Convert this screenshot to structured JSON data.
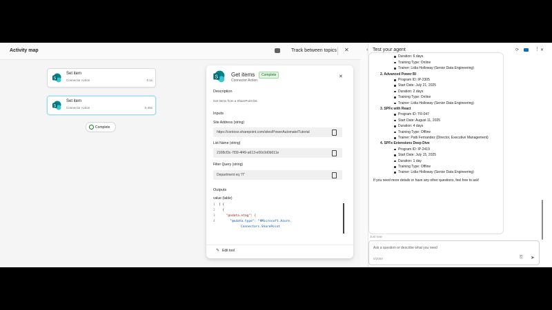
{
  "map": {
    "title": "Activity map",
    "track_label": "Track between topics",
    "nodes": [
      {
        "title": "Set item",
        "subtitle": "Connector Action",
        "meta": "0.1s"
      },
      {
        "title": "Set item",
        "subtitle": "Connector Action",
        "meta": "0.45s"
      }
    ],
    "complete_label": "Complete"
  },
  "panel": {
    "title": "Get items",
    "badge": "Complete",
    "subtitle": "Connector Action",
    "description_heading": "Description",
    "description": "Get items from a SharePoint list.",
    "inputs_heading": "Inputs",
    "fields": [
      {
        "label": "Site Address (string)",
        "value": "https://contoso.sharepoint.com/sites/PowerAutomate/Tutorial"
      },
      {
        "label": "List Name (string)",
        "value": "2108cf3c-7f39-4f49-a613-e00c0d0b011e"
      },
      {
        "label": "Filter Query (string)",
        "value": "Department eq 'IT'"
      }
    ],
    "outputs_heading": "Outputs",
    "value_label": "value (table)",
    "code_lines": [
      {
        "num": "1",
        "text": "[ {"
      },
      {
        "num": "2",
        "text": "  {"
      },
      {
        "num": "3",
        "text": "    \"@odata.etag\": {"
      },
      {
        "num": "4",
        "text": "      \"@odata.type\": \"#Microsoft.Azure."
      }
    ],
    "code_extra": "Connectors.SharePoint",
    "edit_label": "Edit tool"
  },
  "chat": {
    "title": "Test your agent",
    "lines": [
      {
        "text": "Start Date: July 15, 2025",
        "indent": 2,
        "bullet": true
      },
      {
        "text": "Duration: 6 days",
        "indent": 2,
        "bullet": true
      },
      {
        "text": "Training Type: Online",
        "indent": 2,
        "bullet": true
      },
      {
        "text": "Trainer: Lidia Holloway (Senior Data Engineering)",
        "indent": 2,
        "bullet": true
      },
      {
        "text": "2. Advanced Power BI",
        "indent": 1,
        "bullet": false
      },
      {
        "text": "Program ID: IP-2305",
        "indent": 2,
        "bullet": true
      },
      {
        "text": "Start Date: July 21, 2025",
        "indent": 2,
        "bullet": true
      },
      {
        "text": "Duration: 2 days",
        "indent": 2,
        "bullet": true
      },
      {
        "text": "Training Type: Online",
        "indent": 2,
        "bullet": true
      },
      {
        "text": "Trainer: Lidia Holloway (Senior Data Engineering)",
        "indent": 2,
        "bullet": true
      },
      {
        "text": "3. SPFx with React",
        "indent": 1,
        "bullet": false
      },
      {
        "text": "Program ID: TR-047",
        "indent": 2,
        "bullet": true
      },
      {
        "text": "Start Date: August 11, 2025",
        "indent": 2,
        "bullet": true
      },
      {
        "text": "Duration: 4 days",
        "indent": 2,
        "bullet": true
      },
      {
        "text": "Training Type: Offline",
        "indent": 2,
        "bullet": true
      },
      {
        "text": "Trainer: Patti Fernandez (Director, Executive Management)",
        "indent": 2,
        "bullet": true
      },
      {
        "text": "4. SPFx Extensions Deep Dive",
        "indent": 1,
        "bullet": false
      },
      {
        "text": "Program ID: IP-2419",
        "indent": 2,
        "bullet": true
      },
      {
        "text": "Start Date: July 15, 2025",
        "indent": 2,
        "bullet": true
      },
      {
        "text": "Duration: 1 day",
        "indent": 2,
        "bullet": true
      },
      {
        "text": "Training Type: Offline",
        "indent": 2,
        "bullet": true
      },
      {
        "text": "Trainer: Lidia Holloway (Senior Data Engineering)",
        "indent": 2,
        "bullet": true
      },
      {
        "text": "If you need more details or have any other questions, feel free to ask!",
        "indent": 0,
        "bullet": false
      }
    ],
    "timestamp": "Just now",
    "input_placeholder": "Ask a question or describe what you need",
    "char_count": "0/2000"
  }
}
